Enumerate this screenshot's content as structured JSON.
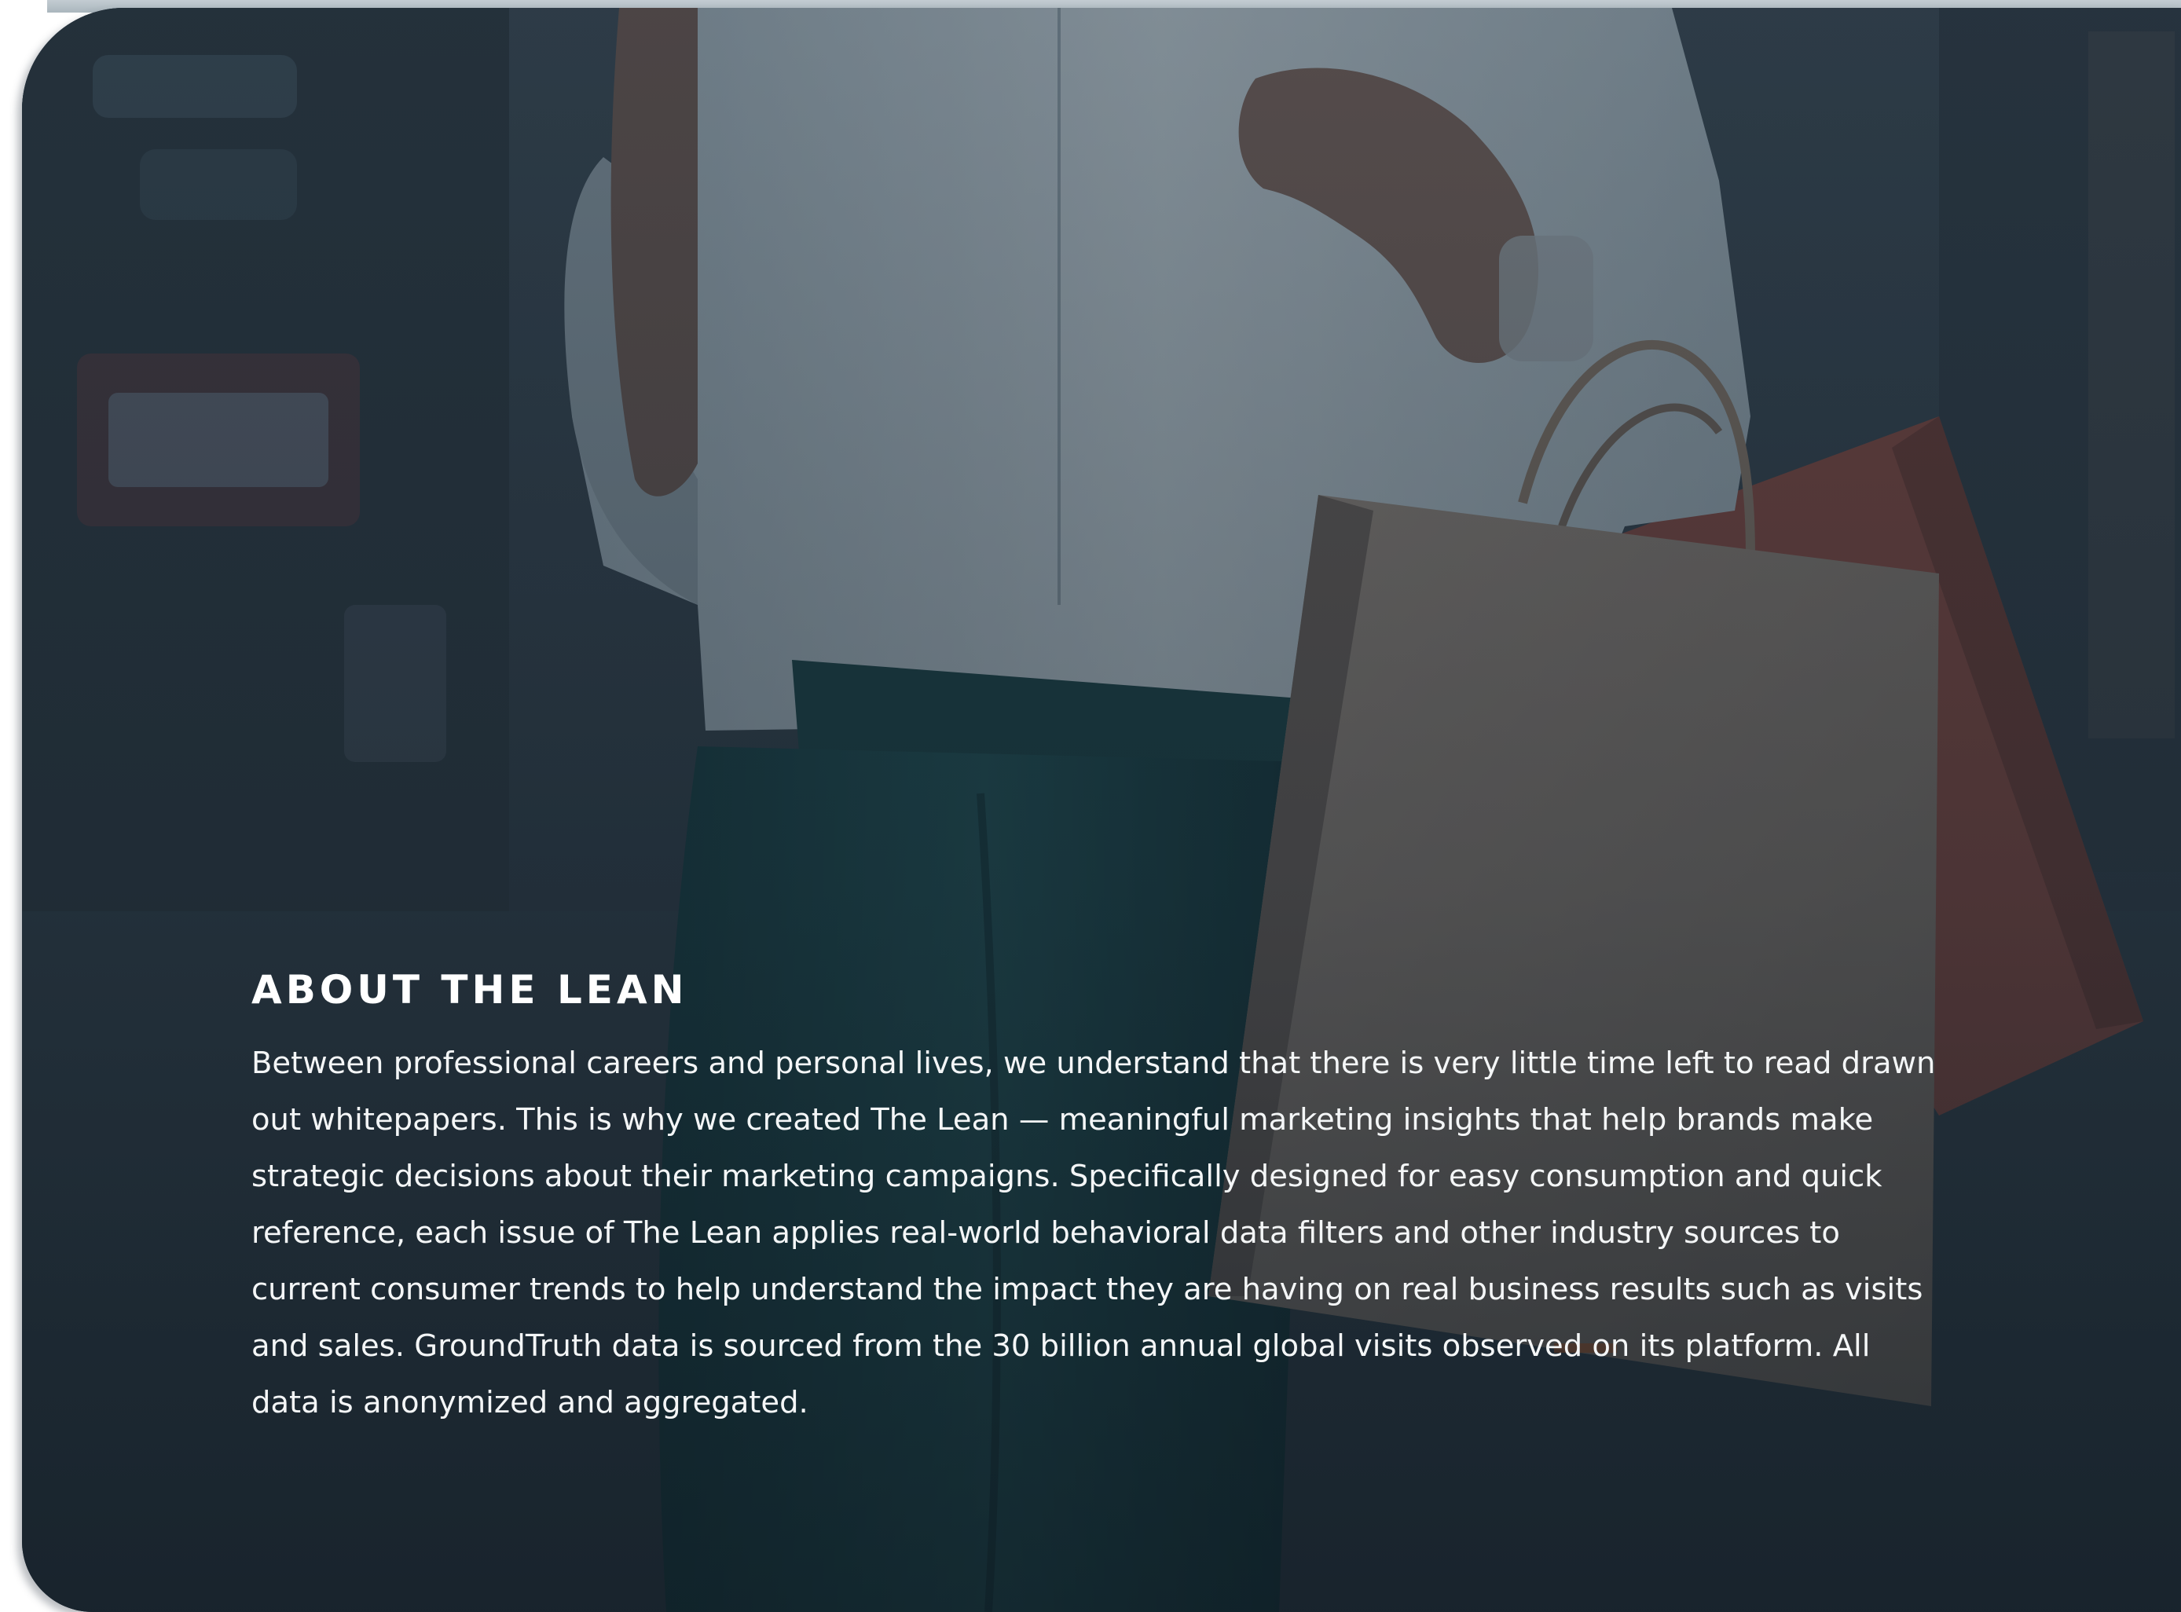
{
  "about": {
    "heading": "ABOUT THE LEAN",
    "body": "Between professional careers and personal lives, we understand that there is very little time left to read drawn out whitepapers. This is why we created The Lean — meaningful marketing insights that help brands make strategic decisions about their marketing campaigns. Specifically designed for easy consumption and quick reference, each issue of The Lean applies real-world behavioral data filters and other industry sources to current consumer trends to help understand the impact they are having on real business results such as visits and sales. GroundTruth data is sourced from the 30 billion annual global visits observed on its platform. All data is anonymized and aggregated."
  },
  "colors": {
    "overlay": "#1d2b36",
    "text": "#ffffff",
    "card_edge": "#aab6bd"
  }
}
